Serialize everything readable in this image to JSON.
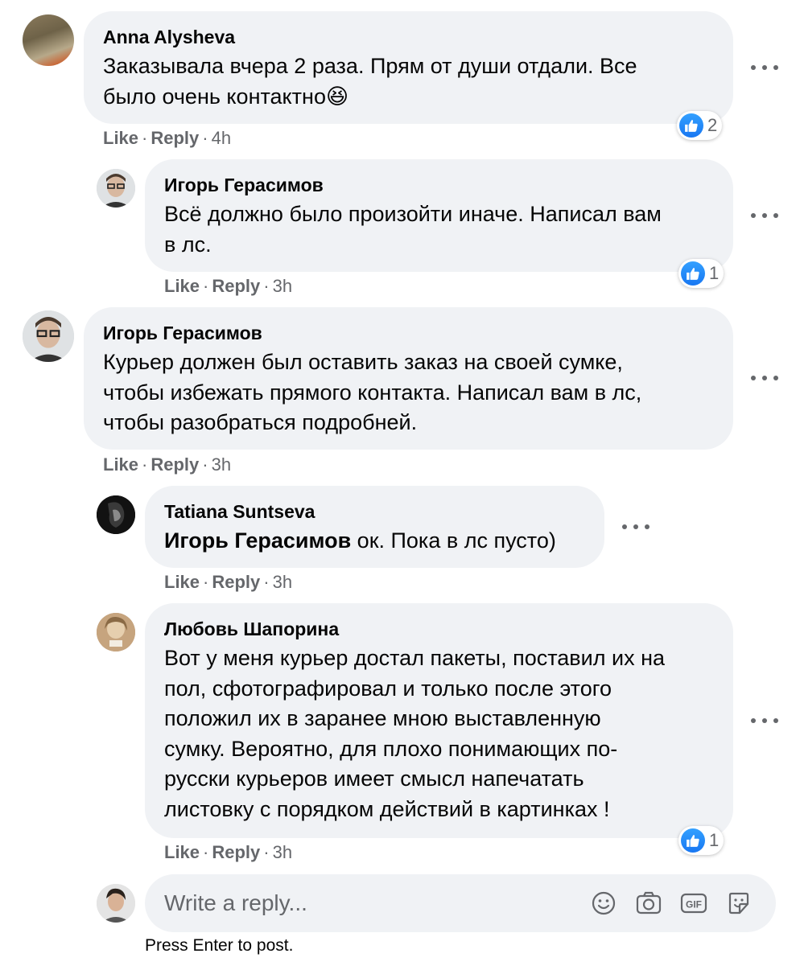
{
  "comments": [
    {
      "author": "Anna Alysheva",
      "lines": [
        "Заказывала вчера 2 раза. Прям от души отдали. Все",
        "было очень контактно"
      ],
      "emoji": "😆",
      "like": "Like",
      "reply": "Reply",
      "time": "4h",
      "reactions": "2"
    },
    {
      "author": "Игорь Герасимов",
      "lines": [
        "Всё должно было произойти иначе. Написал вам",
        "в лс."
      ],
      "like": "Like",
      "reply": "Reply",
      "time": "3h",
      "reactions": "1"
    },
    {
      "author": "Игорь Герасимов",
      "lines": [
        "Курьер должен был оставить заказ на своей сумке,",
        "чтобы избежать прямого контакта. Написал вам в лс,",
        "чтобы разобраться подробней."
      ],
      "like": "Like",
      "reply": "Reply",
      "time": "3h"
    },
    {
      "author": "Tatiana Suntseva",
      "mention": "Игорь Герасимов",
      "text": " ок. Пока в лс пусто)",
      "like": "Like",
      "reply": "Reply",
      "time": "3h"
    },
    {
      "author": "Любовь Шапорина",
      "lines": [
        "Вот у меня курьер достал пакеты, поставил их на",
        "пол, сфотографировал и только после этого",
        "положил их в заранее мною выставленную",
        "сумку. Вероятно, для плохо понимающих по-",
        "русски курьеров имеет смысл напечатать",
        "листовку с порядком действий в картинках !"
      ],
      "like": "Like",
      "reply": "Reply",
      "time": "3h",
      "reactions": "1"
    }
  ],
  "composer": {
    "placeholder": "Write a reply...",
    "hint": "Press Enter to post.",
    "tools": [
      "emoji-icon",
      "camera-icon",
      "gif-icon",
      "sticker-icon"
    ]
  },
  "colors": {
    "bubble": "#f0f2f5",
    "like_blue": "#1877f2",
    "secondary_text": "#65676b"
  }
}
